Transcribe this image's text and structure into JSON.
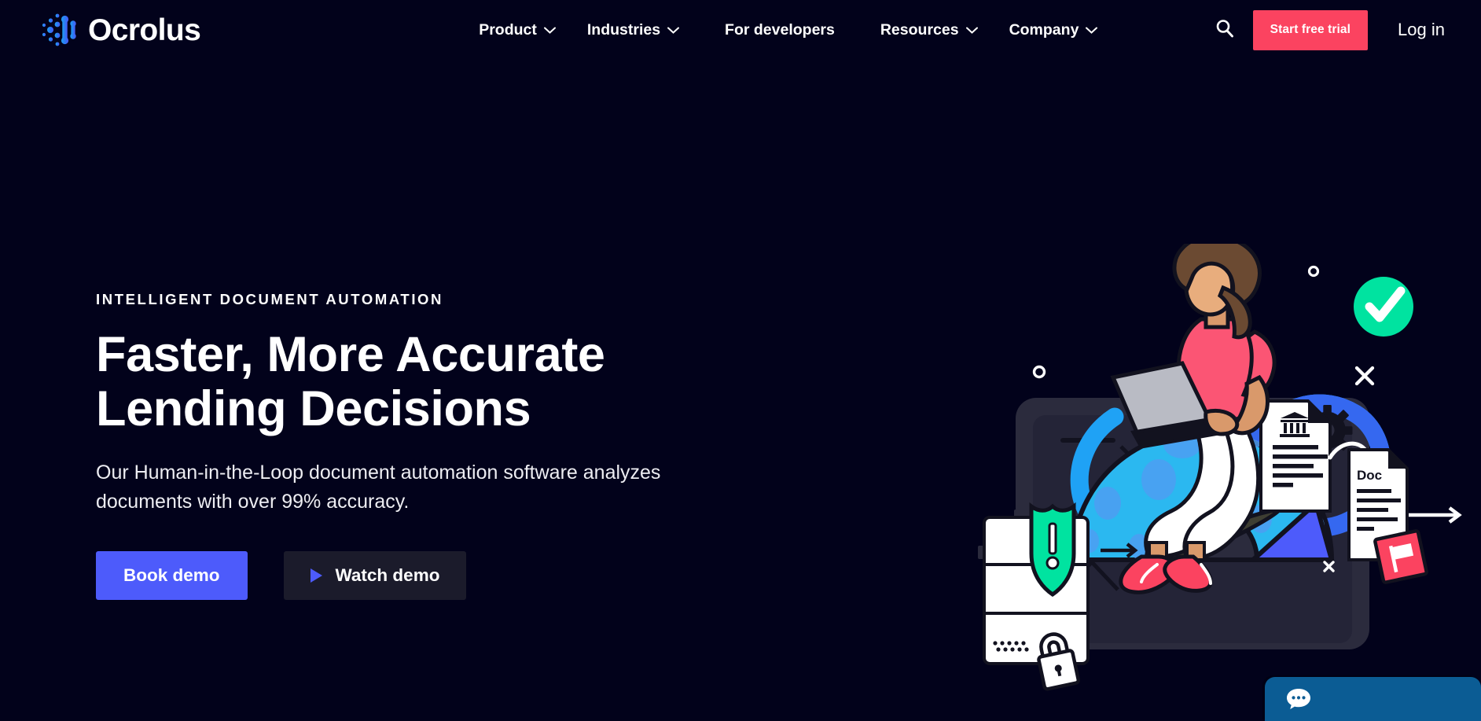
{
  "brand": {
    "name": "Ocrolus",
    "logo_icon": "ocrolus-dot-matrix-logo",
    "accent_pink": "#FB4360",
    "accent_indigo": "#4D5BFB",
    "accent_blue": "#1FA2F5",
    "accent_green": "#00E3A0",
    "background": "#02021B"
  },
  "nav": {
    "items": [
      {
        "label": "Product",
        "has_dropdown": true,
        "icon": "chevron-down-icon"
      },
      {
        "label": "Industries",
        "has_dropdown": true,
        "icon": "chevron-down-icon"
      },
      {
        "label": "For developers",
        "has_dropdown": false,
        "icon": ""
      },
      {
        "label": "Resources",
        "has_dropdown": true,
        "icon": "chevron-down-icon"
      },
      {
        "label": "Company",
        "has_dropdown": true,
        "icon": "chevron-down-icon"
      }
    ],
    "search_icon": "search-icon",
    "cta_label": "Start free trial",
    "login_label": "Log in"
  },
  "hero": {
    "eyebrow": "Intelligent Document Automation",
    "title_line1": "Faster, More Accurate",
    "title_line2": "Lending Decisions",
    "subtitle": "Our Human-in-the-Loop document automation software analyzes documents with over 99% accuracy.",
    "primary_button": "Book demo",
    "secondary_button": "Watch demo",
    "play_icon": "play-icon"
  },
  "illustration": {
    "name": "person-with-laptop-document-automation-illustration",
    "doc_label": "Doc",
    "elements": [
      "infinity-loop",
      "woman-on-laptop",
      "green-check-badge",
      "monitor-screen",
      "shield-alert-icon",
      "lock-icon",
      "gear-icon",
      "globe",
      "bank-document",
      "doc-document",
      "pink-flag-badge",
      "arrow-right",
      "x-mark"
    ]
  },
  "chat": {
    "icon": "chat-bubble-icon",
    "label": ""
  }
}
